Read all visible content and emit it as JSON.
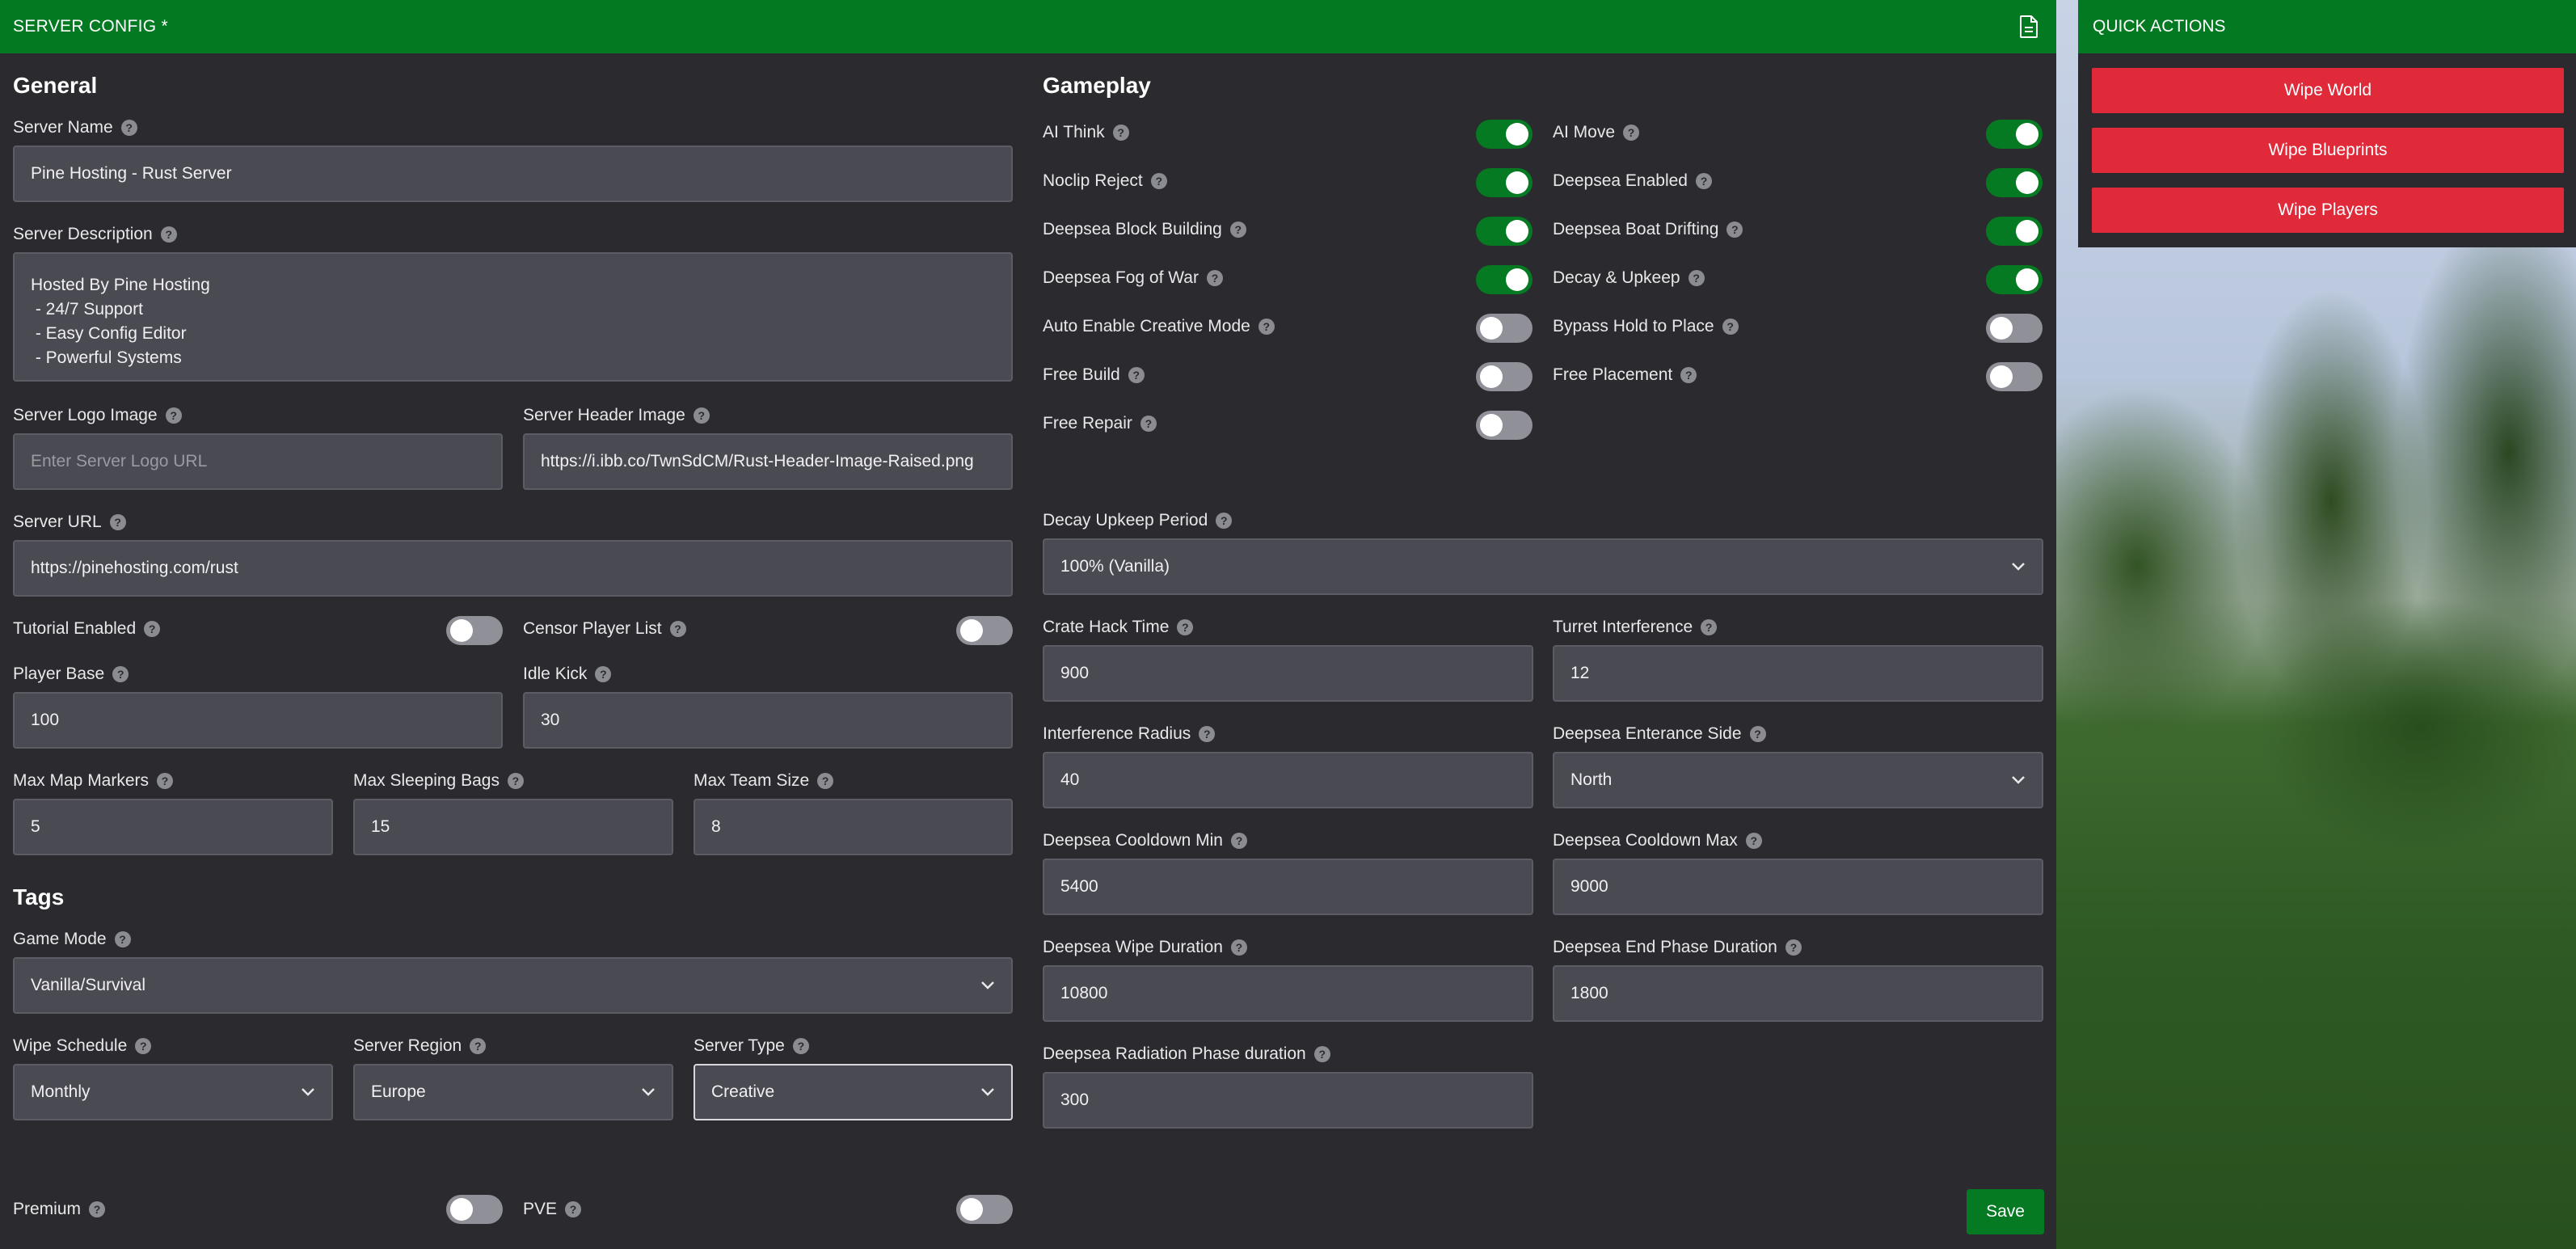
{
  "panel": {
    "title": "SERVER CONFIG *",
    "icon": "file-icon"
  },
  "general": {
    "title": "General",
    "server_name": {
      "label": "Server Name",
      "value": "Pine Hosting - Rust Server"
    },
    "server_description": {
      "label": "Server Description",
      "value": "Hosted By Pine Hosting\n - 24/7 Support\n - Easy Config Editor\n - Powerful Systems"
    },
    "server_logo": {
      "label": "Server Logo Image",
      "placeholder": "Enter Server Logo URL"
    },
    "server_header": {
      "label": "Server Header Image",
      "value": "https://i.ibb.co/TwnSdCM/Rust-Header-Image-Raised.png"
    },
    "server_url": {
      "label": "Server URL",
      "value": "https://pinehosting.com/rust"
    },
    "tutorial_enabled": {
      "label": "Tutorial Enabled",
      "on": false
    },
    "censor_player_list": {
      "label": "Censor Player List",
      "on": false
    },
    "player_base": {
      "label": "Player Base",
      "value": "100"
    },
    "idle_kick": {
      "label": "Idle Kick",
      "value": "30"
    },
    "max_map_markers": {
      "label": "Max Map Markers",
      "value": "5"
    },
    "max_sleeping_bags": {
      "label": "Max Sleeping Bags",
      "value": "15"
    },
    "max_team_size": {
      "label": "Max Team Size",
      "value": "8"
    }
  },
  "tags": {
    "title": "Tags",
    "game_mode": {
      "label": "Game Mode",
      "value": "Vanilla/Survival"
    },
    "wipe_schedule": {
      "label": "Wipe Schedule",
      "value": "Monthly"
    },
    "server_region": {
      "label": "Server Region",
      "value": "Europe"
    },
    "server_type": {
      "label": "Server Type",
      "value": "Creative"
    },
    "premium": {
      "label": "Premium",
      "on": false
    },
    "pve": {
      "label": "PVE",
      "on": false
    }
  },
  "gameplay": {
    "title": "Gameplay",
    "toggles": [
      {
        "label": "AI Think",
        "on": true
      },
      {
        "label": "AI Move",
        "on": true
      },
      {
        "label": "Noclip Reject",
        "on": true
      },
      {
        "label": "Deepsea Enabled",
        "on": true
      },
      {
        "label": "Deepsea Block Building",
        "on": true
      },
      {
        "label": "Deepsea Boat Drifting",
        "on": true
      },
      {
        "label": "Deepsea Fog of War",
        "on": true
      },
      {
        "label": "Decay & Upkeep",
        "on": true
      },
      {
        "label": "Auto Enable Creative Mode",
        "on": false
      },
      {
        "label": "Bypass Hold to Place",
        "on": false
      },
      {
        "label": "Free Build",
        "on": false
      },
      {
        "label": "Free Placement",
        "on": false
      },
      {
        "label": "Free Repair",
        "on": false
      }
    ],
    "decay_upkeep_period": {
      "label": "Decay Upkeep Period",
      "value": "100% (Vanilla)"
    },
    "crate_hack_time": {
      "label": "Crate Hack Time",
      "value": "900"
    },
    "turret_interference": {
      "label": "Turret Interference",
      "value": "12"
    },
    "interference_radius": {
      "label": "Interference Radius",
      "value": "40"
    },
    "deepsea_entrance_side": {
      "label": "Deepsea Enterance Side",
      "value": "North"
    },
    "deepsea_cooldown_min": {
      "label": "Deepsea Cooldown Min",
      "value": "5400"
    },
    "deepsea_cooldown_max": {
      "label": "Deepsea Cooldown Max",
      "value": "9000"
    },
    "deepsea_wipe_duration": {
      "label": "Deepsea Wipe Duration",
      "value": "10800"
    },
    "deepsea_end_phase_duration": {
      "label": "Deepsea End Phase Duration",
      "value": "1800"
    },
    "deepsea_radiation_phase_duration": {
      "label": "Deepsea Radiation Phase duration",
      "value": "300"
    }
  },
  "save_label": "Save",
  "quick_actions": {
    "title": "QUICK ACTIONS",
    "buttons": [
      "Wipe World",
      "Wipe Blueprints",
      "Wipe Players"
    ]
  },
  "colors": {
    "header_green": "#037a22",
    "panel_bg": "#2b2b2f",
    "field_bg": "#4a4a52",
    "danger_red": "#e02a3a"
  }
}
